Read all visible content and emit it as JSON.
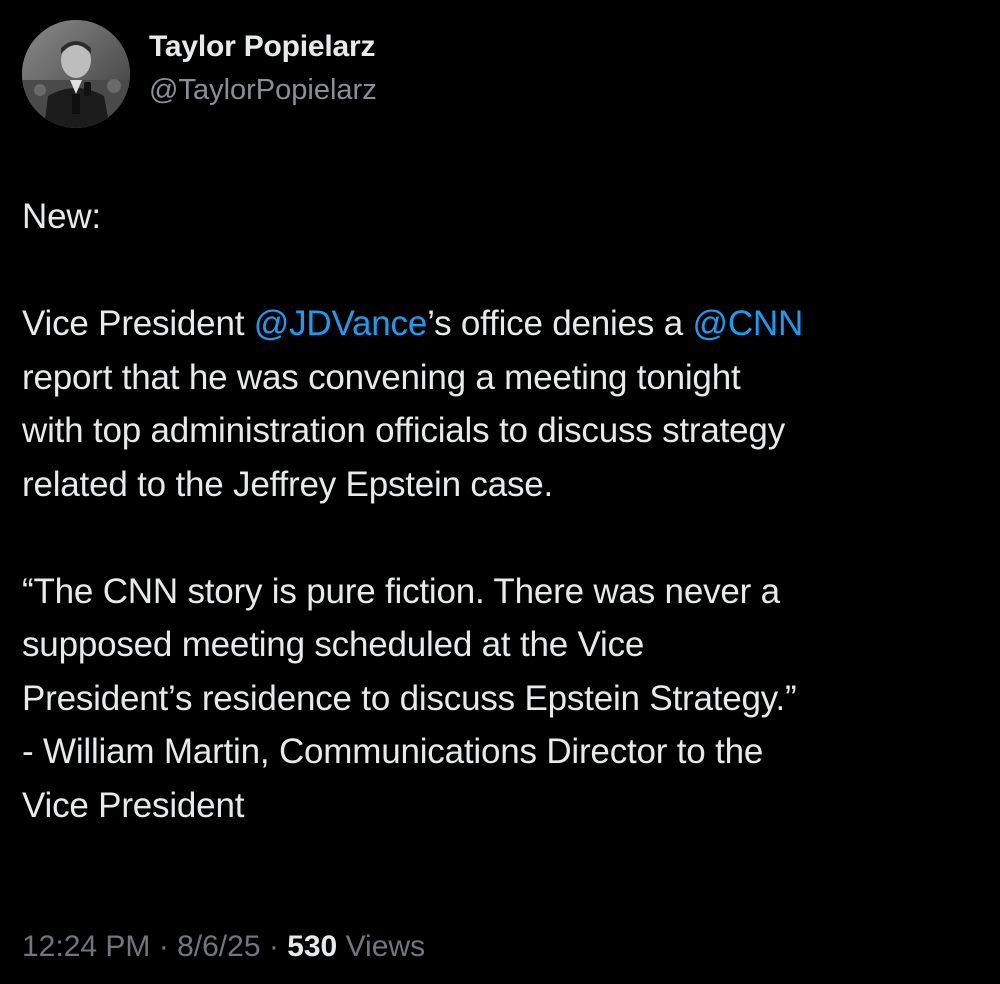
{
  "author": {
    "display_name": "Taylor Popielarz",
    "handle": "@TaylorPopielarz",
    "avatar_icon": "profile-photo"
  },
  "tweet": {
    "intro": "New:",
    "para1": {
      "t1": "Vice President ",
      "mention1": "@JDVance",
      "t2": "’s office denies a ",
      "mention2": "@CNN",
      "line2": "report that he was convening a meeting tonight",
      "line3": "with top administration officials to discuss strategy",
      "line4": "related to the Jeffrey Epstein case."
    },
    "quote_lines": [
      "“The CNN story is pure fiction. There was never a",
      "supposed meeting scheduled at the Vice",
      "President’s residence to discuss Epstein Strategy.”",
      "- William Martin, Communications Director to the",
      "Vice President"
    ]
  },
  "meta": {
    "time": "12:24 PM",
    "separator": " · ",
    "date": "8/6/25",
    "views_count": "530",
    "views_label": " Views"
  },
  "colors": {
    "background": "#000000",
    "text": "#e7e9ea",
    "secondary": "#71767b",
    "mention": "#1d9bf0"
  }
}
